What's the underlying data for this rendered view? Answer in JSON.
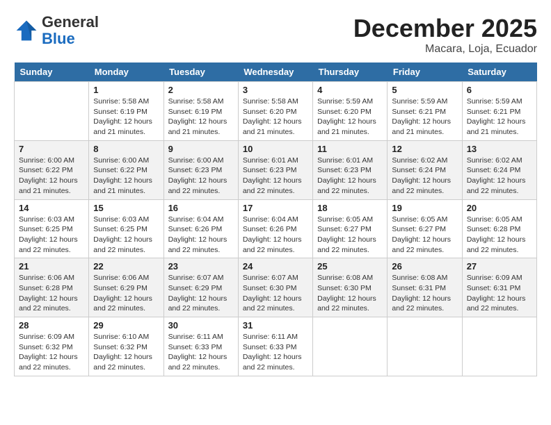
{
  "header": {
    "logo": {
      "general": "General",
      "blue": "Blue"
    },
    "title": "December 2025",
    "subtitle": "Macara, Loja, Ecuador"
  },
  "days_of_week": [
    "Sunday",
    "Monday",
    "Tuesday",
    "Wednesday",
    "Thursday",
    "Friday",
    "Saturday"
  ],
  "weeks": [
    [
      {
        "day": "",
        "info": ""
      },
      {
        "day": "1",
        "info": "Sunrise: 5:58 AM\nSunset: 6:19 PM\nDaylight: 12 hours\nand 21 minutes."
      },
      {
        "day": "2",
        "info": "Sunrise: 5:58 AM\nSunset: 6:19 PM\nDaylight: 12 hours\nand 21 minutes."
      },
      {
        "day": "3",
        "info": "Sunrise: 5:58 AM\nSunset: 6:20 PM\nDaylight: 12 hours\nand 21 minutes."
      },
      {
        "day": "4",
        "info": "Sunrise: 5:59 AM\nSunset: 6:20 PM\nDaylight: 12 hours\nand 21 minutes."
      },
      {
        "day": "5",
        "info": "Sunrise: 5:59 AM\nSunset: 6:21 PM\nDaylight: 12 hours\nand 21 minutes."
      },
      {
        "day": "6",
        "info": "Sunrise: 5:59 AM\nSunset: 6:21 PM\nDaylight: 12 hours\nand 21 minutes."
      }
    ],
    [
      {
        "day": "7",
        "info": "Sunrise: 6:00 AM\nSunset: 6:22 PM\nDaylight: 12 hours\nand 21 minutes."
      },
      {
        "day": "8",
        "info": "Sunrise: 6:00 AM\nSunset: 6:22 PM\nDaylight: 12 hours\nand 21 minutes."
      },
      {
        "day": "9",
        "info": "Sunrise: 6:00 AM\nSunset: 6:23 PM\nDaylight: 12 hours\nand 22 minutes."
      },
      {
        "day": "10",
        "info": "Sunrise: 6:01 AM\nSunset: 6:23 PM\nDaylight: 12 hours\nand 22 minutes."
      },
      {
        "day": "11",
        "info": "Sunrise: 6:01 AM\nSunset: 6:23 PM\nDaylight: 12 hours\nand 22 minutes."
      },
      {
        "day": "12",
        "info": "Sunrise: 6:02 AM\nSunset: 6:24 PM\nDaylight: 12 hours\nand 22 minutes."
      },
      {
        "day": "13",
        "info": "Sunrise: 6:02 AM\nSunset: 6:24 PM\nDaylight: 12 hours\nand 22 minutes."
      }
    ],
    [
      {
        "day": "14",
        "info": "Sunrise: 6:03 AM\nSunset: 6:25 PM\nDaylight: 12 hours\nand 22 minutes."
      },
      {
        "day": "15",
        "info": "Sunrise: 6:03 AM\nSunset: 6:25 PM\nDaylight: 12 hours\nand 22 minutes."
      },
      {
        "day": "16",
        "info": "Sunrise: 6:04 AM\nSunset: 6:26 PM\nDaylight: 12 hours\nand 22 minutes."
      },
      {
        "day": "17",
        "info": "Sunrise: 6:04 AM\nSunset: 6:26 PM\nDaylight: 12 hours\nand 22 minutes."
      },
      {
        "day": "18",
        "info": "Sunrise: 6:05 AM\nSunset: 6:27 PM\nDaylight: 12 hours\nand 22 minutes."
      },
      {
        "day": "19",
        "info": "Sunrise: 6:05 AM\nSunset: 6:27 PM\nDaylight: 12 hours\nand 22 minutes."
      },
      {
        "day": "20",
        "info": "Sunrise: 6:05 AM\nSunset: 6:28 PM\nDaylight: 12 hours\nand 22 minutes."
      }
    ],
    [
      {
        "day": "21",
        "info": "Sunrise: 6:06 AM\nSunset: 6:28 PM\nDaylight: 12 hours\nand 22 minutes."
      },
      {
        "day": "22",
        "info": "Sunrise: 6:06 AM\nSunset: 6:29 PM\nDaylight: 12 hours\nand 22 minutes."
      },
      {
        "day": "23",
        "info": "Sunrise: 6:07 AM\nSunset: 6:29 PM\nDaylight: 12 hours\nand 22 minutes."
      },
      {
        "day": "24",
        "info": "Sunrise: 6:07 AM\nSunset: 6:30 PM\nDaylight: 12 hours\nand 22 minutes."
      },
      {
        "day": "25",
        "info": "Sunrise: 6:08 AM\nSunset: 6:30 PM\nDaylight: 12 hours\nand 22 minutes."
      },
      {
        "day": "26",
        "info": "Sunrise: 6:08 AM\nSunset: 6:31 PM\nDaylight: 12 hours\nand 22 minutes."
      },
      {
        "day": "27",
        "info": "Sunrise: 6:09 AM\nSunset: 6:31 PM\nDaylight: 12 hours\nand 22 minutes."
      }
    ],
    [
      {
        "day": "28",
        "info": "Sunrise: 6:09 AM\nSunset: 6:32 PM\nDaylight: 12 hours\nand 22 minutes."
      },
      {
        "day": "29",
        "info": "Sunrise: 6:10 AM\nSunset: 6:32 PM\nDaylight: 12 hours\nand 22 minutes."
      },
      {
        "day": "30",
        "info": "Sunrise: 6:11 AM\nSunset: 6:33 PM\nDaylight: 12 hours\nand 22 minutes."
      },
      {
        "day": "31",
        "info": "Sunrise: 6:11 AM\nSunset: 6:33 PM\nDaylight: 12 hours\nand 22 minutes."
      },
      {
        "day": "",
        "info": ""
      },
      {
        "day": "",
        "info": ""
      },
      {
        "day": "",
        "info": ""
      }
    ]
  ]
}
